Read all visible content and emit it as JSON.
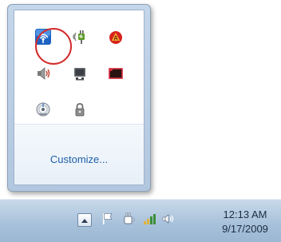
{
  "overflow_panel": {
    "customize_label": "Customize...",
    "icons": [
      {
        "name": "wireless-network-icon"
      },
      {
        "name": "power-plug-icon"
      },
      {
        "name": "antivirus-icon"
      },
      {
        "name": "speaker-icon"
      },
      {
        "name": "display-icon"
      },
      {
        "name": "record-icon"
      },
      {
        "name": "disc-icon"
      },
      {
        "name": "lock-icon"
      }
    ],
    "highlight_color": "#d42a2a"
  },
  "taskbar": {
    "icons": [
      "triangle-up-icon",
      "flag-icon",
      "power-icon",
      "network-bars-icon",
      "volume-icon"
    ],
    "time": "12:13 AM",
    "date": "9/17/2009"
  }
}
